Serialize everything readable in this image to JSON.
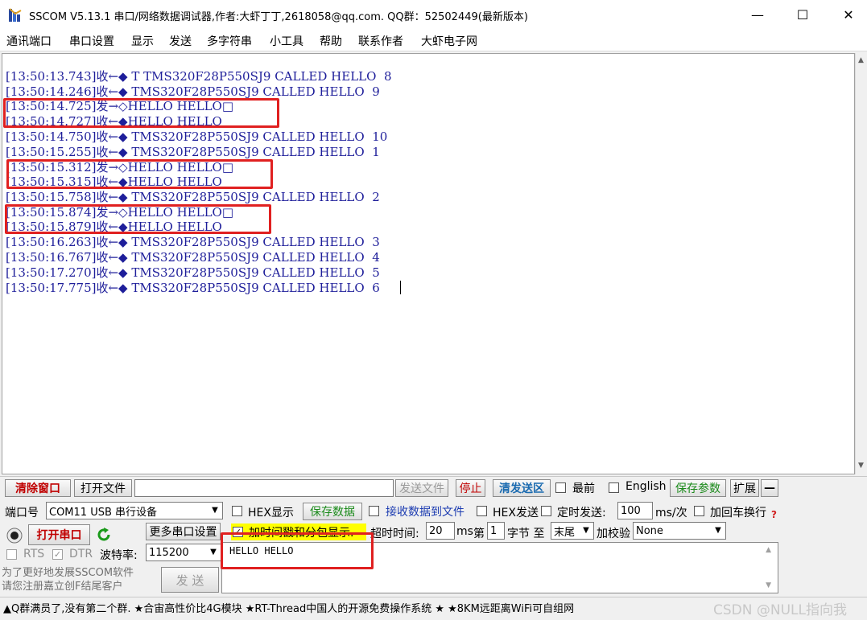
{
  "window": {
    "title": "SSCOM V5.13.1 串口/网络数据调试器,作者:大虾丁丁,2618058@qq.com. QQ群：52502449(最新版本)",
    "min_label": "—",
    "max_label": "☐",
    "close_label": "✕"
  },
  "menu": [
    "通讯端口",
    "串口设置",
    "显示",
    "发送",
    "多字符串",
    "小工具",
    "帮助",
    "联系作者",
    "大虾电子网"
  ],
  "receive_log": [
    "[13:50:13.743]收←◆ T TMS320F28P550SJ9 CALLED HELLO  8",
    "[13:50:14.246]收←◆ TMS320F28P550SJ9 CALLED HELLO  9",
    "[13:50:14.725]发→◇HELLO HELLO□",
    "[13:50:14.727]收←◆HELLO HELLO",
    "[13:50:14.750]收←◆ TMS320F28P550SJ9 CALLED HELLO  10",
    "[13:50:15.255]收←◆ TMS320F28P550SJ9 CALLED HELLO  1",
    "[13:50:15.312]发→◇HELLO HELLO□",
    "[13:50:15.315]收←◆HELLO HELLO",
    "[13:50:15.758]收←◆ TMS320F28P550SJ9 CALLED HELLO  2",
    "[13:50:15.874]发→◇HELLO HELLO□",
    "[13:50:15.879]收←◆HELLO HELLO",
    "[13:50:16.263]收←◆ TMS320F28P550SJ9 CALLED HELLO  3",
    "[13:50:16.767]收←◆ TMS320F28P550SJ9 CALLED HELLO  4",
    "[13:50:17.270]收←◆ TMS320F28P550SJ9 CALLED HELLO  5",
    "[13:50:17.775]收←◆ TMS320F28P550SJ9 CALLED HELLO  6"
  ],
  "toolbar1": {
    "clear_window": "清除窗口",
    "open_file": "打开文件",
    "file_path": "",
    "send_file": "发送文件",
    "stop": "停止",
    "clear_send": "清发送区",
    "last_label": "最前",
    "english_label": "English",
    "save_params": "保存参数",
    "expand": "扩展",
    "collapse": "—"
  },
  "port": {
    "port_label": "端口号",
    "port_value": "COM11 USB 串行设备",
    "open_port": "打开串口",
    "more_settings": "更多串口设置",
    "rts_label": "RTS",
    "dtr_label": "DTR",
    "baud_label": "波特率:",
    "baud_value": "115200"
  },
  "options": {
    "hex_display": "HEX显示",
    "save_data": "保存数据",
    "recv_to_file": "接收数据到文件",
    "hex_send": "HEX发送",
    "timed_send": "定时发送:",
    "timed_ms": "100",
    "ms_per": "ms/次",
    "add_crlf": "加回车换行",
    "help_mark": "?",
    "timestamp": "加时间戳和分包显示.",
    "timeout_label": "超时时间:",
    "timeout_value": "20",
    "ms": "ms",
    "byte_prefix": "第",
    "byte_value": "1",
    "byte_suffix": "字节 至",
    "tail_value": "末尾",
    "checksum_label": "加校验",
    "checksum_value": "None"
  },
  "send": {
    "text": "HELLO HELLO",
    "send_button": "发 送"
  },
  "promo": {
    "line1": "为了更好地发展SSCOM软件",
    "line2": "请您注册嘉立创F结尾客户"
  },
  "status": {
    "marquee": "▲Q群满员了,没有第二个群. ★合宙高性价比4G模块 ★RT-Thread中国人的开源免费操作系统 ★ ★8KM远距离WiFi可自组网",
    "watermark": "CSDN @NULL指向我"
  },
  "colors": {
    "log_text": "#1e1e9a",
    "highlight_box": "#e02020",
    "accent_red": "#c00000",
    "accent_green": "#1a8a1a",
    "timestamp_highlight": "#ffff00"
  }
}
